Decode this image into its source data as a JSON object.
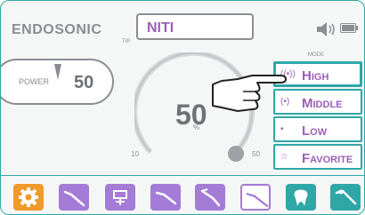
{
  "header": {
    "title": "ENDOSONIC",
    "tip_label": "TIP",
    "tip_value": "NITI",
    "mode_label": "MODE"
  },
  "power": {
    "label": "POWER",
    "value": "50"
  },
  "dial": {
    "value": "50",
    "unit": "%",
    "min_label": "10",
    "max_label": "50",
    "level_fraction": 1.0
  },
  "modes": [
    {
      "label": "High",
      "icon": "waves-strong-icon",
      "active": true
    },
    {
      "label": "Middle",
      "icon": "waves-medium-icon",
      "active": false
    },
    {
      "label": "Low",
      "icon": "waves-weak-icon",
      "active": false
    },
    {
      "label": "Favorite",
      "icon": "star-icon",
      "active": false
    }
  ],
  "toolbar": [
    {
      "name": "settings-button",
      "icon": "gear-icon",
      "style": "orange"
    },
    {
      "name": "tip-1-button",
      "icon": "file-tip-icon",
      "style": "purple"
    },
    {
      "name": "tip-2-button",
      "icon": "tip-holder-icon",
      "style": "purple"
    },
    {
      "name": "tip-3-button",
      "icon": "file-tip-icon",
      "style": "purple"
    },
    {
      "name": "tip-4-button",
      "icon": "file-tip-icon",
      "style": "purple"
    },
    {
      "name": "tip-5-button",
      "icon": "file-tip-icon",
      "style": "outline"
    },
    {
      "name": "tooth-button",
      "icon": "tooth-icon",
      "style": "teal"
    },
    {
      "name": "tip-6-button",
      "icon": "file-tip-icon",
      "style": "teal"
    }
  ],
  "colors": {
    "accent": "#2fa7a6",
    "purple": "#9b5fb7",
    "orange": "#ef9a2a",
    "gray": "#8a8d91"
  }
}
